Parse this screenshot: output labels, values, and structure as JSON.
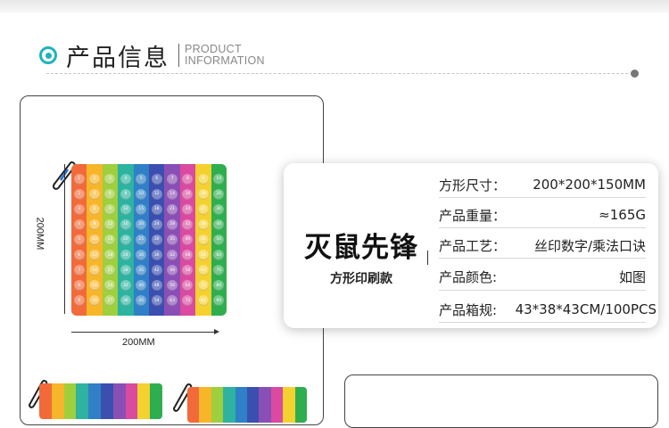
{
  "header": {
    "title_cn": "产品信息",
    "title_en_line1": "PRODUCT",
    "title_en_line2": "INFORMATION"
  },
  "product_image": {
    "dimension_width": "200MM",
    "dimension_height": "200MM",
    "column_colors": [
      "#f26a3a",
      "#f7b52a",
      "#9fcf3c",
      "#2db3a0",
      "#2f80c7",
      "#3a4fb0",
      "#8a4fb5",
      "#d94aa0",
      "#f4d12e",
      "#2fae4f"
    ],
    "board_numbers": [
      [
        "1",
        "2",
        "3",
        "4",
        "5",
        "6",
        "7",
        "8",
        "9",
        "10"
      ],
      [
        "2",
        "4",
        "6",
        "8",
        "10",
        "12",
        "14",
        "16",
        "18",
        "20"
      ],
      [
        "3",
        "6",
        "9",
        "12",
        "15",
        "18",
        "21",
        "24",
        "27",
        "30"
      ],
      [
        "4",
        "8",
        "12",
        "16",
        "20",
        "24",
        "28",
        "32",
        "36",
        "40"
      ],
      [
        "5",
        "10",
        "15",
        "20",
        "25",
        "30",
        "35",
        "40",
        "45",
        "50"
      ],
      [
        "6",
        "12",
        "18",
        "24",
        "30",
        "36",
        "42",
        "48",
        "54",
        "60"
      ],
      [
        "7",
        "14",
        "21",
        "28",
        "35",
        "42",
        "49",
        "56",
        "63",
        "70"
      ],
      [
        "8",
        "16",
        "24",
        "32",
        "40",
        "48",
        "56",
        "64",
        "72",
        "80"
      ],
      [
        "9",
        "18",
        "27",
        "36",
        "45",
        "54",
        "63",
        "72",
        "81",
        "90"
      ]
    ]
  },
  "product": {
    "name": "灭鼠先锋",
    "subtitle": "方形印刷款"
  },
  "specs": [
    {
      "label": "方形尺寸：",
      "value": "200*200*150MM"
    },
    {
      "label": "产品重量：",
      "value": "≈165G"
    },
    {
      "label": "产品工艺：",
      "value": "丝印数字/乘法口诀"
    },
    {
      "label": "产品颜色:",
      "value": "如图"
    },
    {
      "label": "产品箱规:",
      "value": "43*38*43CM/100PCS"
    }
  ]
}
